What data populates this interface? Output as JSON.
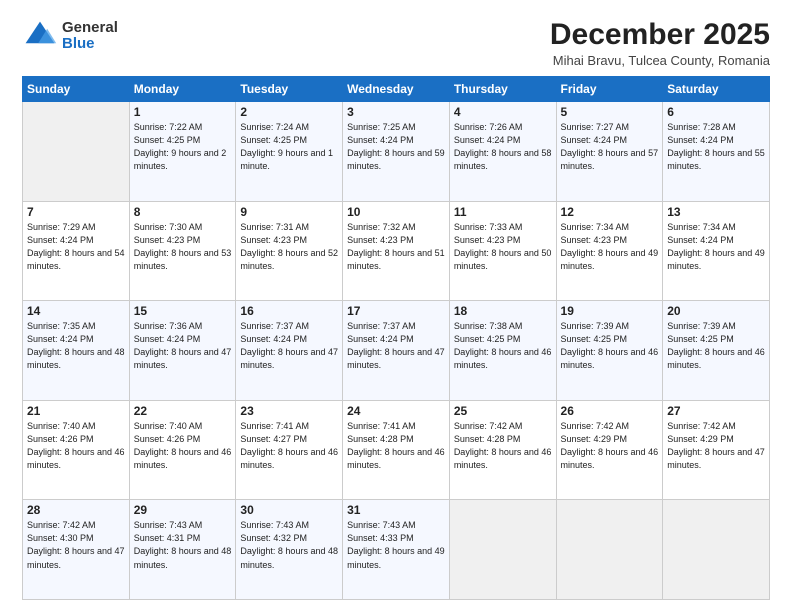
{
  "logo": {
    "general": "General",
    "blue": "Blue"
  },
  "title": "December 2025",
  "subtitle": "Mihai Bravu, Tulcea County, Romania",
  "days_of_week": [
    "Sunday",
    "Monday",
    "Tuesday",
    "Wednesday",
    "Thursday",
    "Friday",
    "Saturday"
  ],
  "weeks": [
    [
      {
        "day": null,
        "info": null
      },
      {
        "day": "1",
        "sunrise": "Sunrise: 7:22 AM",
        "sunset": "Sunset: 4:25 PM",
        "daylight": "Daylight: 9 hours and 2 minutes."
      },
      {
        "day": "2",
        "sunrise": "Sunrise: 7:24 AM",
        "sunset": "Sunset: 4:25 PM",
        "daylight": "Daylight: 9 hours and 1 minute."
      },
      {
        "day": "3",
        "sunrise": "Sunrise: 7:25 AM",
        "sunset": "Sunset: 4:24 PM",
        "daylight": "Daylight: 8 hours and 59 minutes."
      },
      {
        "day": "4",
        "sunrise": "Sunrise: 7:26 AM",
        "sunset": "Sunset: 4:24 PM",
        "daylight": "Daylight: 8 hours and 58 minutes."
      },
      {
        "day": "5",
        "sunrise": "Sunrise: 7:27 AM",
        "sunset": "Sunset: 4:24 PM",
        "daylight": "Daylight: 8 hours and 57 minutes."
      },
      {
        "day": "6",
        "sunrise": "Sunrise: 7:28 AM",
        "sunset": "Sunset: 4:24 PM",
        "daylight": "Daylight: 8 hours and 55 minutes."
      }
    ],
    [
      {
        "day": "7",
        "sunrise": "Sunrise: 7:29 AM",
        "sunset": "Sunset: 4:24 PM",
        "daylight": "Daylight: 8 hours and 54 minutes."
      },
      {
        "day": "8",
        "sunrise": "Sunrise: 7:30 AM",
        "sunset": "Sunset: 4:23 PM",
        "daylight": "Daylight: 8 hours and 53 minutes."
      },
      {
        "day": "9",
        "sunrise": "Sunrise: 7:31 AM",
        "sunset": "Sunset: 4:23 PM",
        "daylight": "Daylight: 8 hours and 52 minutes."
      },
      {
        "day": "10",
        "sunrise": "Sunrise: 7:32 AM",
        "sunset": "Sunset: 4:23 PM",
        "daylight": "Daylight: 8 hours and 51 minutes."
      },
      {
        "day": "11",
        "sunrise": "Sunrise: 7:33 AM",
        "sunset": "Sunset: 4:23 PM",
        "daylight": "Daylight: 8 hours and 50 minutes."
      },
      {
        "day": "12",
        "sunrise": "Sunrise: 7:34 AM",
        "sunset": "Sunset: 4:23 PM",
        "daylight": "Daylight: 8 hours and 49 minutes."
      },
      {
        "day": "13",
        "sunrise": "Sunrise: 7:34 AM",
        "sunset": "Sunset: 4:24 PM",
        "daylight": "Daylight: 8 hours and 49 minutes."
      }
    ],
    [
      {
        "day": "14",
        "sunrise": "Sunrise: 7:35 AM",
        "sunset": "Sunset: 4:24 PM",
        "daylight": "Daylight: 8 hours and 48 minutes."
      },
      {
        "day": "15",
        "sunrise": "Sunrise: 7:36 AM",
        "sunset": "Sunset: 4:24 PM",
        "daylight": "Daylight: 8 hours and 47 minutes."
      },
      {
        "day": "16",
        "sunrise": "Sunrise: 7:37 AM",
        "sunset": "Sunset: 4:24 PM",
        "daylight": "Daylight: 8 hours and 47 minutes."
      },
      {
        "day": "17",
        "sunrise": "Sunrise: 7:37 AM",
        "sunset": "Sunset: 4:24 PM",
        "daylight": "Daylight: 8 hours and 47 minutes."
      },
      {
        "day": "18",
        "sunrise": "Sunrise: 7:38 AM",
        "sunset": "Sunset: 4:25 PM",
        "daylight": "Daylight: 8 hours and 46 minutes."
      },
      {
        "day": "19",
        "sunrise": "Sunrise: 7:39 AM",
        "sunset": "Sunset: 4:25 PM",
        "daylight": "Daylight: 8 hours and 46 minutes."
      },
      {
        "day": "20",
        "sunrise": "Sunrise: 7:39 AM",
        "sunset": "Sunset: 4:25 PM",
        "daylight": "Daylight: 8 hours and 46 minutes."
      }
    ],
    [
      {
        "day": "21",
        "sunrise": "Sunrise: 7:40 AM",
        "sunset": "Sunset: 4:26 PM",
        "daylight": "Daylight: 8 hours and 46 minutes."
      },
      {
        "day": "22",
        "sunrise": "Sunrise: 7:40 AM",
        "sunset": "Sunset: 4:26 PM",
        "daylight": "Daylight: 8 hours and 46 minutes."
      },
      {
        "day": "23",
        "sunrise": "Sunrise: 7:41 AM",
        "sunset": "Sunset: 4:27 PM",
        "daylight": "Daylight: 8 hours and 46 minutes."
      },
      {
        "day": "24",
        "sunrise": "Sunrise: 7:41 AM",
        "sunset": "Sunset: 4:28 PM",
        "daylight": "Daylight: 8 hours and 46 minutes."
      },
      {
        "day": "25",
        "sunrise": "Sunrise: 7:42 AM",
        "sunset": "Sunset: 4:28 PM",
        "daylight": "Daylight: 8 hours and 46 minutes."
      },
      {
        "day": "26",
        "sunrise": "Sunrise: 7:42 AM",
        "sunset": "Sunset: 4:29 PM",
        "daylight": "Daylight: 8 hours and 46 minutes."
      },
      {
        "day": "27",
        "sunrise": "Sunrise: 7:42 AM",
        "sunset": "Sunset: 4:29 PM",
        "daylight": "Daylight: 8 hours and 47 minutes."
      }
    ],
    [
      {
        "day": "28",
        "sunrise": "Sunrise: 7:42 AM",
        "sunset": "Sunset: 4:30 PM",
        "daylight": "Daylight: 8 hours and 47 minutes."
      },
      {
        "day": "29",
        "sunrise": "Sunrise: 7:43 AM",
        "sunset": "Sunset: 4:31 PM",
        "daylight": "Daylight: 8 hours and 48 minutes."
      },
      {
        "day": "30",
        "sunrise": "Sunrise: 7:43 AM",
        "sunset": "Sunset: 4:32 PM",
        "daylight": "Daylight: 8 hours and 48 minutes."
      },
      {
        "day": "31",
        "sunrise": "Sunrise: 7:43 AM",
        "sunset": "Sunset: 4:33 PM",
        "daylight": "Daylight: 8 hours and 49 minutes."
      },
      {
        "day": null,
        "info": null
      },
      {
        "day": null,
        "info": null
      },
      {
        "day": null,
        "info": null
      }
    ]
  ]
}
